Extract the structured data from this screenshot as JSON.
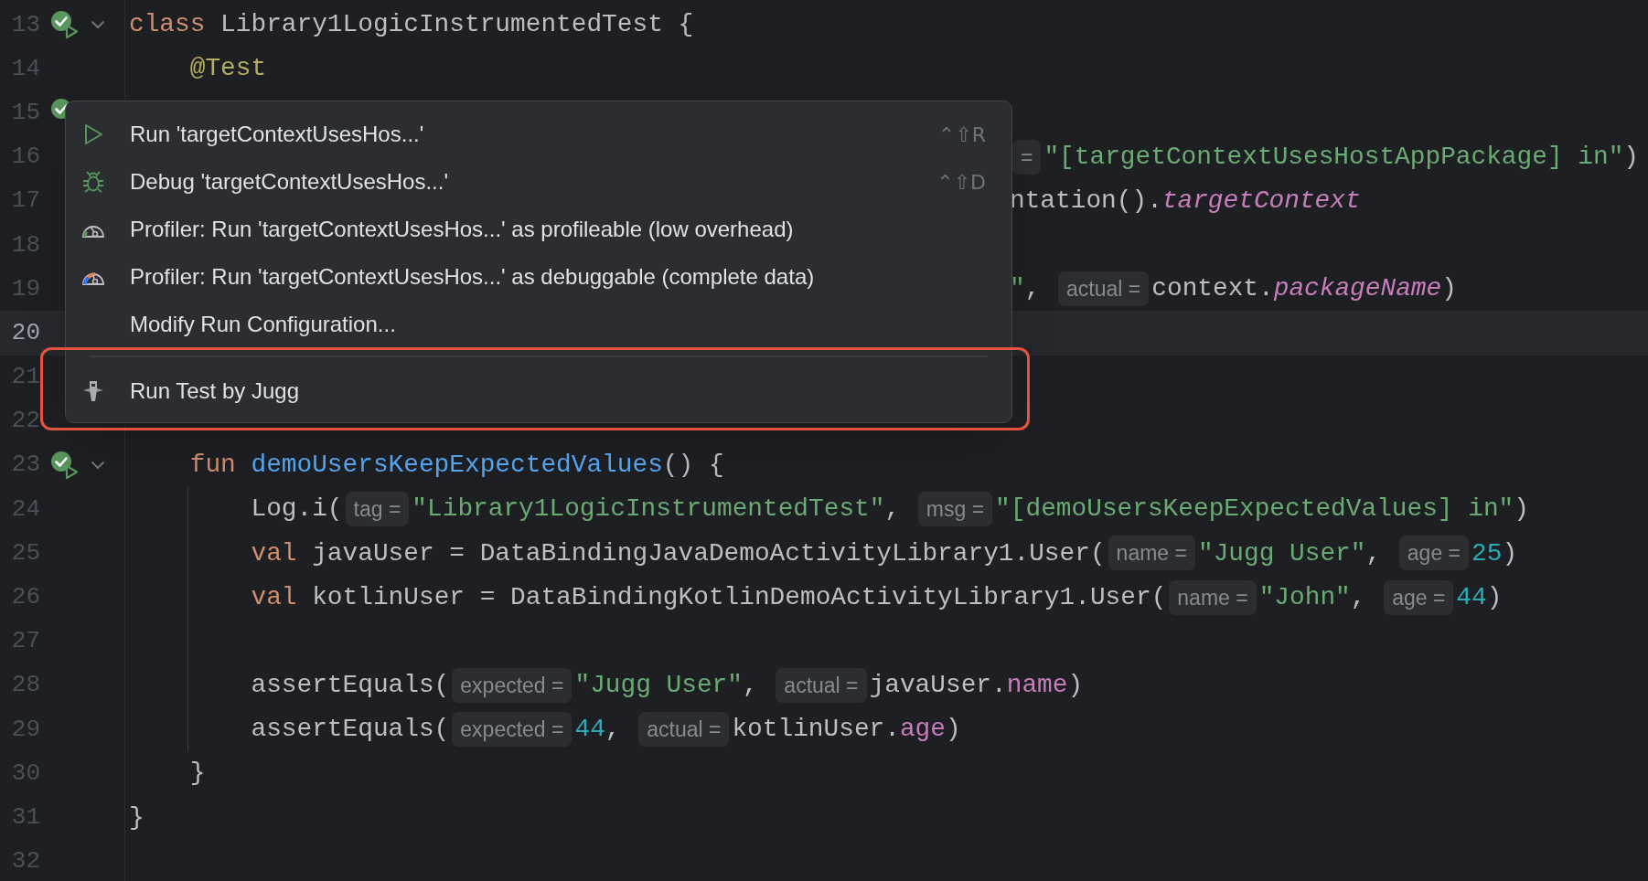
{
  "editor": {
    "lines": [
      {
        "number": "13",
        "current": false,
        "gutter_icon": true,
        "fold": true,
        "segments": [
          {
            "kind": "keyword",
            "text": "class"
          },
          {
            "kind": "plain",
            "text": " Library1LogicInstrumentedTest {"
          }
        ]
      },
      {
        "number": "14",
        "current": false,
        "gutter_icon": false,
        "fold": false,
        "segments": [
          {
            "kind": "annotation",
            "text": "    @Test"
          }
        ]
      },
      {
        "number": "15",
        "current": false,
        "gutter_icon": true
      },
      {
        "number": "16",
        "current": false,
        "gutter_icon": false,
        "covered": true,
        "segments": [
          {
            "kind": "hint",
            "text": "="
          },
          {
            "kind": "string",
            "text": "\"[targetContextUsesHostAppPackage] in\""
          },
          {
            "kind": "plain",
            "text": ")"
          }
        ]
      },
      {
        "number": "17",
        "current": false,
        "gutter_icon": false,
        "covered": true,
        "segments": [
          {
            "kind": "plain",
            "text": "ntation()."
          },
          {
            "kind": "extension",
            "text": "targetContext"
          }
        ]
      },
      {
        "number": "18",
        "current": false,
        "gutter_icon": false
      },
      {
        "number": "19",
        "current": false,
        "gutter_icon": false,
        "covered": true,
        "segments": [
          {
            "kind": "string",
            "text": "\""
          },
          {
            "kind": "plain",
            "text": ", "
          },
          {
            "kind": "hint",
            "text": "actual ="
          },
          {
            "kind": "plain",
            "text": "context."
          },
          {
            "kind": "extension",
            "text": "packageName"
          },
          {
            "kind": "plain",
            "text": ")"
          }
        ]
      },
      {
        "number": "20",
        "current": true,
        "gutter_icon": false
      },
      {
        "number": "21",
        "current": false,
        "gutter_icon": false
      },
      {
        "number": "22",
        "current": false,
        "gutter_icon": false
      },
      {
        "number": "23",
        "current": false,
        "gutter_icon": true,
        "fold": true,
        "segments": [
          {
            "kind": "keyword",
            "text": "    fun "
          },
          {
            "kind": "function",
            "text": "demoUsersKeepExpectedValues"
          },
          {
            "kind": "plain",
            "text": "() {"
          }
        ]
      },
      {
        "number": "24",
        "current": false,
        "gutter_icon": false,
        "fold": false,
        "covered": false,
        "segments": [
          {
            "kind": "plain",
            "text": "        Log.i("
          },
          {
            "kind": "hint",
            "text": "tag ="
          },
          {
            "kind": "string",
            "text": "\"Library1LogicInstrumentedTest\""
          },
          {
            "kind": "plain",
            "text": ", "
          },
          {
            "kind": "hint",
            "text": "msg ="
          },
          {
            "kind": "string",
            "text": "\"[demoUsersKeepExpectedValues] in\""
          },
          {
            "kind": "plain",
            "text": ")"
          }
        ]
      },
      {
        "number": "25",
        "current": false,
        "gutter_icon": false,
        "fold": false,
        "covered": false,
        "segments": [
          {
            "kind": "keyword",
            "text": "        val"
          },
          {
            "kind": "plain",
            "text": " javaUser = DataBindingJavaDemoActivityLibrary1.User("
          },
          {
            "kind": "hint",
            "text": "name ="
          },
          {
            "kind": "string",
            "text": "\"Jugg User\""
          },
          {
            "kind": "plain",
            "text": ", "
          },
          {
            "kind": "hint",
            "text": "age ="
          },
          {
            "kind": "number",
            "text": "25"
          },
          {
            "kind": "plain",
            "text": ")"
          }
        ]
      },
      {
        "number": "26",
        "current": false,
        "gutter_icon": false,
        "fold": false,
        "covered": false,
        "segments": [
          {
            "kind": "keyword",
            "text": "        val"
          },
          {
            "kind": "plain",
            "text": " kotlinUser = DataBindingKotlinDemoActivityLibrary1.User("
          },
          {
            "kind": "hint",
            "text": "name ="
          },
          {
            "kind": "string",
            "text": "\"John\""
          },
          {
            "kind": "plain",
            "text": ", "
          },
          {
            "kind": "hint",
            "text": "age ="
          },
          {
            "kind": "number",
            "text": "44"
          },
          {
            "kind": "plain",
            "text": ")"
          }
        ]
      },
      {
        "number": "27",
        "current": false,
        "gutter_icon": false,
        "fold": false
      },
      {
        "number": "28",
        "current": false,
        "gutter_icon": false,
        "fold": false,
        "covered": false,
        "segments": [
          {
            "kind": "plain",
            "text": "        assertEquals("
          },
          {
            "kind": "hint",
            "text": "expected ="
          },
          {
            "kind": "string",
            "text": "\"Jugg User\""
          },
          {
            "kind": "plain",
            "text": ", "
          },
          {
            "kind": "hint",
            "text": "actual ="
          },
          {
            "kind": "plain",
            "text": "javaUser."
          },
          {
            "kind": "property",
            "text": "name"
          },
          {
            "kind": "plain",
            "text": ")"
          }
        ]
      },
      {
        "number": "29",
        "current": false,
        "gutter_icon": false,
        "fold": false,
        "covered": false,
        "segments": [
          {
            "kind": "plain",
            "text": "        assertEquals("
          },
          {
            "kind": "hint",
            "text": "expected ="
          },
          {
            "kind": "number",
            "text": "44"
          },
          {
            "kind": "plain",
            "text": ", "
          },
          {
            "kind": "hint",
            "text": "actual ="
          },
          {
            "kind": "plain",
            "text": "kotlinUser."
          },
          {
            "kind": "property",
            "text": "age"
          },
          {
            "kind": "plain",
            "text": ")"
          }
        ]
      },
      {
        "number": "30",
        "current": false,
        "gutter_icon": false,
        "fold": false,
        "segments": [
          {
            "kind": "plain",
            "text": "    }"
          }
        ]
      },
      {
        "number": "31",
        "current": false,
        "gutter_icon": false,
        "fold": false,
        "segments": [
          {
            "kind": "plain",
            "text": "}"
          }
        ]
      },
      {
        "number": "32",
        "current": false,
        "gutter_icon": false,
        "fold": false
      }
    ]
  },
  "popup": {
    "items": [
      {
        "kind": "run",
        "label": "Run 'targetContextUsesHos...'",
        "shortcut": "⌃⇧R",
        "highlighted": false
      },
      {
        "kind": "debug",
        "label": "Debug 'targetContextUsesHos...'",
        "shortcut": "⌃⇧D",
        "highlighted": false
      },
      {
        "kind": "profile_low",
        "label": "Profiler: Run 'targetContextUsesHos...' as profileable (low overhead)",
        "highlighted": false
      },
      {
        "kind": "profile_debug",
        "label": "Profiler: Run 'targetContextUsesHos...' as debuggable (complete data)",
        "highlighted": false
      },
      {
        "kind": "plain",
        "label": "Modify Run Configuration...",
        "highlighted": false
      },
      {
        "kind": "separator"
      },
      {
        "kind": "plugin",
        "label": "Run Test by Jugg",
        "highlighted": true
      }
    ]
  }
}
